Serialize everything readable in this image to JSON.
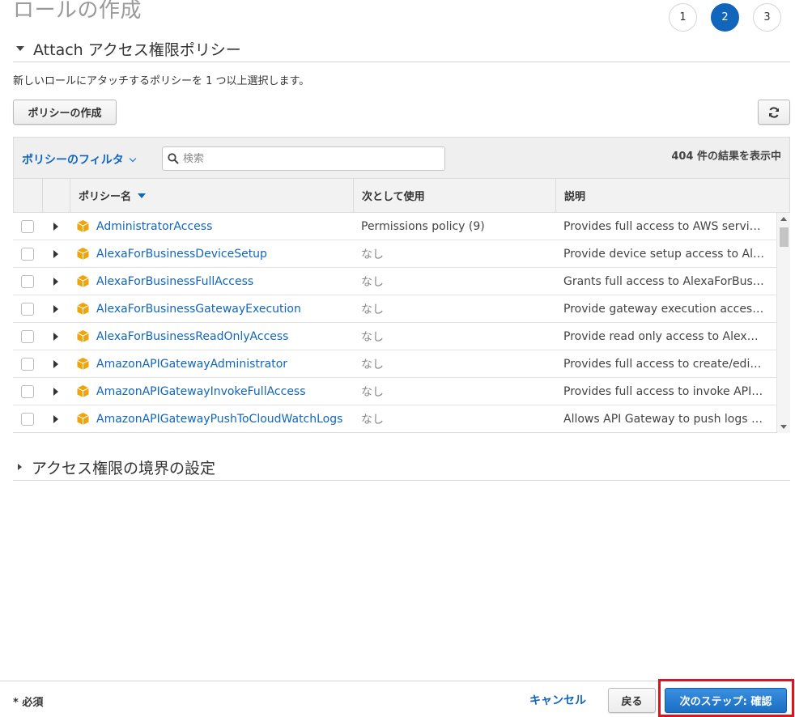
{
  "header": {
    "title": "ロールの作成",
    "steps": [
      {
        "label": "1",
        "active": false
      },
      {
        "label": "2",
        "active": true
      },
      {
        "label": "3",
        "active": false
      }
    ]
  },
  "attach_section": {
    "title": "Attach アクセス権限ポリシー",
    "description": "新しいロールにアタッチするポリシーを 1 つ以上選択します。",
    "create_policy_button": "ポリシーの作成",
    "refresh_icon": "refresh-icon"
  },
  "filter": {
    "label": "ポリシーのフィルタ",
    "search_placeholder": "検索",
    "search_value": "",
    "result_count": "404 件の結果を表示中"
  },
  "table": {
    "columns": {
      "name": "ポリシー名",
      "used_as": "次として使用",
      "description": "説明"
    },
    "rows": [
      {
        "name": "AdministratorAccess",
        "used_as": "Permissions policy (9)",
        "description": "Provides full access to AWS services and resources."
      },
      {
        "name": "AlexaForBusinessDeviceSetup",
        "used_as": "なし",
        "description": "Provide device setup access to AlexaForBusiness services"
      },
      {
        "name": "AlexaForBusinessFullAccess",
        "used_as": "なし",
        "description": "Grants full access to AlexaForBusiness resources"
      },
      {
        "name": "AlexaForBusinessGatewayExecution",
        "used_as": "なし",
        "description": "Provide gateway execution access to AlexaForBusiness"
      },
      {
        "name": "AlexaForBusinessReadOnlyAccess",
        "used_as": "なし",
        "description": "Provide read only access to AlexaForBusiness services"
      },
      {
        "name": "AmazonAPIGatewayAdministrator",
        "used_as": "なし",
        "description": "Provides full access to create/edit/delete APIs"
      },
      {
        "name": "AmazonAPIGatewayInvokeFullAccess",
        "used_as": "なし",
        "description": "Provides full access to invoke APIs in Amazon API Gateway"
      },
      {
        "name": "AmazonAPIGatewayPushToCloudWatchLogs",
        "used_as": "なし",
        "description": "Allows API Gateway to push logs to user's account."
      }
    ]
  },
  "boundary_section": {
    "title": "アクセス権限の境界の設定"
  },
  "footer": {
    "required_label": "* 必須",
    "cancel_label": "キャンセル",
    "back_label": "戻る",
    "next_label": "次のステップ: 確認"
  },
  "colors": {
    "accent": "#1166bb",
    "policy_icon": "#f0a30a",
    "highlight": "#e0121d"
  }
}
